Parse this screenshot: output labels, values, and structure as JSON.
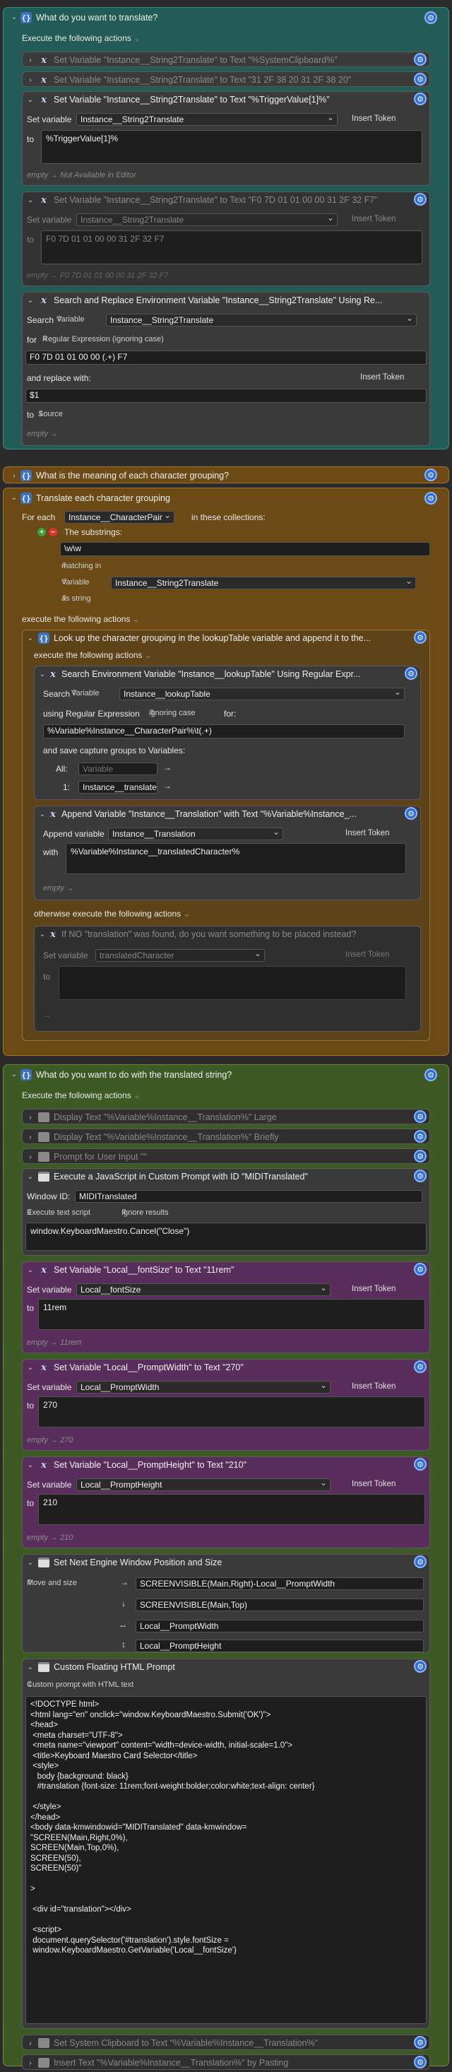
{
  "group1": {
    "title": "What do you want to translate?",
    "execute": "Execute the following actions",
    "a1": "Set Variable \"Instance__String2Translate\" to Text \"%SystemClipboard%\"",
    "a2": "Set Variable \"Instance__String2Translate\" to Text \"31 2F 38  20 31 2F 38  20\"",
    "a3": {
      "title": "Set Variable \"Instance__String2Translate\" to Text \"%TriggerValue[1]%\"",
      "setvar": "Set variable",
      "var": "Instance__String2Translate",
      "insert": "Insert Token",
      "to": "to",
      "value": "%TriggerValue[1]%",
      "empty": "empty → Not Available in Editor"
    },
    "a4": {
      "title": "Set Variable \"Instance__String2Translate\" to Text \"F0 7D 01 01 00 00 31 2F 32 F7\"",
      "setvar": "Set variable",
      "var": "Instance__String2Translate",
      "insert": "Insert Token",
      "to": "to",
      "value": "F0 7D 01 01 00 00 31 2F 32 F7",
      "empty": "empty → F0 7D 01 01 00 00 31 2F 32 F7"
    },
    "a5": {
      "title": "Search and Replace Environment Variable \"Instance__String2Translate\" Using Re...",
      "search": "Search",
      "variable": "Variable",
      "var": "Instance__String2Translate",
      "for": "for",
      "regex": "Regular Expression (ignoring case)",
      "pattern": "F0 7D 01 01 00 00 (.+) F7",
      "replace": "and replace with:",
      "insert": "Insert Token",
      "repl": "$1",
      "to": "to",
      "source": "Source",
      "empty": "empty →"
    }
  },
  "group2": {
    "title": "What is the meaning of each character grouping?"
  },
  "group3": {
    "title": "Translate each character grouping",
    "foreach": "For each",
    "var": "Instance__CharacterPair",
    "collections": "in these collections:",
    "substrings": "The substrings:",
    "pattern": "\\w\\w",
    "matching": "matching in",
    "variable": "Variable",
    "var2": "Instance__String2Translate",
    "asstring": "as string",
    "execute": "execute the following actions",
    "b1": {
      "title": "Look up the character grouping in the lookupTable variable and append it to the...",
      "execute": "execute the following actions"
    },
    "b2": {
      "title": "Search Environment Variable \"Instance__lookupTable\" Using Regular Expr...",
      "search": "Search",
      "variable": "Variable",
      "var": "Instance__lookupTable",
      "using": "using Regular Expression",
      "ignoring": "ignoring case",
      "for": "for:",
      "pattern": "%Variable%Instance__CharacterPair%\\t(.+)",
      "save": "and save capture groups to Variables:",
      "all": "All:",
      "allph": "Variable",
      "one": "1:",
      "onevar": "Instance__translatedChar"
    },
    "b3": {
      "title": "Append Variable \"Instance__Translation\" with Text \"%Variable%Instance_...",
      "append": "Append variable",
      "var": "Instance__Translation",
      "insert": "Insert Token",
      "with": "with",
      "value": "%Variable%Instance__translatedCharacter%",
      "empty": "empty →"
    },
    "otherwise": "otherwise execute the following actions",
    "b4": {
      "title": "If NO \"translation\" was found, do you want something to be placed instead?",
      "setvar": "Set variable",
      "var": "translatedCharacter",
      "insert": "Insert Token",
      "to": "to",
      "empty": "→"
    }
  },
  "group4": {
    "title": "What do you want to do with the translated string?",
    "execute": "Execute the following actions",
    "c1": "Display Text \"%Variable%Instance__Translation%\" Large",
    "c2": "Display Text \"%Variable%Instance__Translation%\" Briefly",
    "c3": "Prompt for User Input \"\"",
    "c4": {
      "title": "Execute a JavaScript in Custom Prompt with ID \"MIDITranslated\"",
      "winid": "Window ID:",
      "winval": "MIDITranslated",
      "exec": "Execute text script",
      "ignore": "Ignore results",
      "script": "window.KeyboardMaestro.Cancel(\"Close\")"
    },
    "c5": {
      "title": "Set Variable \"Local__fontSize\" to Text \"11rem\"",
      "setvar": "Set variable",
      "var": "Local__fontSize",
      "insert": "Insert Token",
      "to": "to",
      "value": "11rem",
      "empty": "empty → 11rem"
    },
    "c6": {
      "title": "Set Variable \"Local__PromptWidth\" to Text \"270\"",
      "setvar": "Set variable",
      "var": "Local__PromptWidth",
      "insert": "Insert Token",
      "to": "to",
      "value": "270",
      "empty": "empty → 270"
    },
    "c7": {
      "title": "Set Variable \"Local__PromptHeight\" to Text \"210\"",
      "setvar": "Set variable",
      "var": "Local__PromptHeight",
      "insert": "Insert Token",
      "to": "to",
      "value": "210",
      "empty": "empty → 210"
    },
    "c8": {
      "title": "Set Next Engine Window Position and Size",
      "move": "Move and size",
      "x": "SCREENVISIBLE(Main,Right)-Local__PromptWidth",
      "y": "SCREENVISIBLE(Main,Top)",
      "w": "Local__PromptWidth",
      "h": "Local__PromptHeight"
    },
    "c9": {
      "title": "Custom Floating HTML Prompt",
      "sub": "Custom prompt with HTML text",
      "html": "<!DOCTYPE html>\n<html lang=\"en\" onclick=\"window.KeyboardMaestro.Submit('OK')\">\n<head>\n <meta charset=\"UTF-8\">\n <meta name=\"viewport\" content=\"width=device-width, initial-scale=1.0\">\n <title>Keyboard Maestro Card Selector</title>\n <style>\n   body {background: black}\n   #translation {font-size: 11rem;font-weight:bolder;color:white;text-align: center}\n\n </style>\n</head>\n<body data-kmwindowid=\"MIDITranslated\" data-kmwindow=\n\"SCREEN(Main,Right,0%),\nSCREEN(Main,Top,0%),\nSCREEN(50),\nSCREEN(50)\"\n\n>\n\n <div id=\"translation\"></div>\n\n <script>\n document.querySelector('#translation').style.fontSize =\n window.KeyboardMaestro.GetVariable('Local__fontSize')"
    },
    "c10": "Set System Clipboard to Text \"%Variable%Instance__Translation%\"",
    "c11": "Insert Text \"%Variable%Instance__Translation%\" by Pasting"
  }
}
